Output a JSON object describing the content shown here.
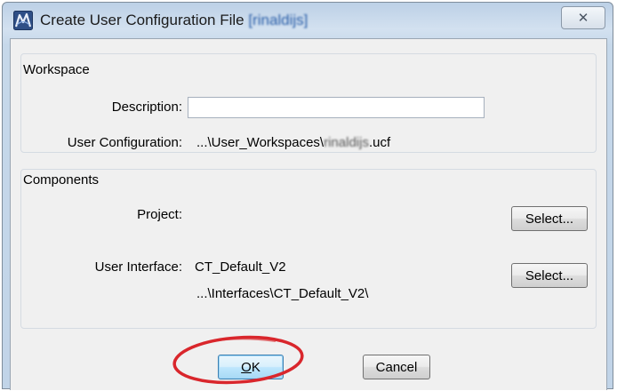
{
  "window": {
    "title_prefix": "Create User Configuration File ",
    "title_user": "[rinaldijs]",
    "close_glyph": "✕"
  },
  "workspace": {
    "group_title": "Workspace",
    "description_label": "Description:",
    "description_value": "",
    "user_config_label": "User Configuration:",
    "user_config_path_prefix": "...\\User_Workspaces\\",
    "user_config_user": "rinaldijs",
    "user_config_ext": ".ucf"
  },
  "components": {
    "group_title": "Components",
    "project_label": "Project:",
    "project_select_label": "Select...",
    "ui_label": "User Interface:",
    "ui_name": "CT_Default_V2",
    "ui_path": "...\\Interfaces\\CT_Default_V2\\",
    "ui_select_label": "Select..."
  },
  "footer": {
    "ok_label": "OK",
    "ok_mnemonic": "O",
    "ok_rest": "K",
    "cancel_label": "Cancel"
  },
  "colors": {
    "highlight_ellipse": "#d9262c",
    "title_user_color": "#1e5ba8"
  },
  "icons": {
    "app": "microstation-logo-icon",
    "close": "close-icon"
  }
}
